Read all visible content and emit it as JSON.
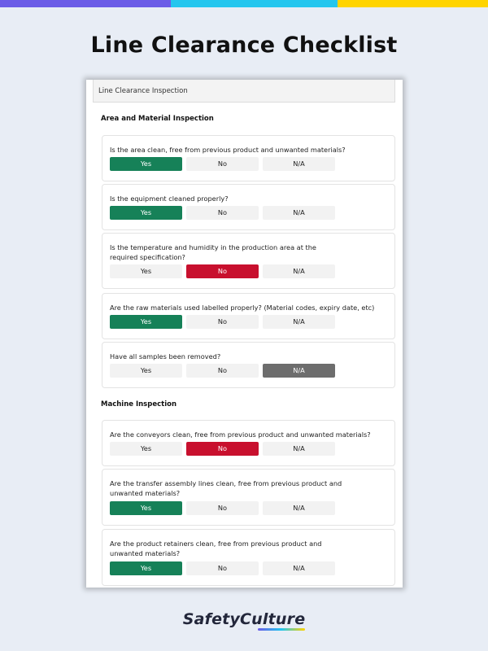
{
  "page": {
    "title": "Line Clearance Checklist"
  },
  "card": {
    "header": "Line Clearance Inspection"
  },
  "sections": [
    {
      "title": "Area and Material Inspection",
      "questions": [
        {
          "text": "Is the area clean, free from previous product and unwanted materials?",
          "options": [
            "Yes",
            "No",
            "N/A"
          ],
          "selected": "Yes"
        },
        {
          "text": "Is the equipment cleaned properly?",
          "options": [
            "Yes",
            "No",
            "N/A"
          ],
          "selected": "Yes"
        },
        {
          "text": "Is the temperature and humidity in the production area at the required specification?",
          "options": [
            "Yes",
            "No",
            "N/A"
          ],
          "selected": "No"
        },
        {
          "text": "Are the raw materials used labelled properly? (Material codes, expiry date, etc)",
          "options": [
            "Yes",
            "No",
            "N/A"
          ],
          "selected": "Yes"
        },
        {
          "text": "Have all samples been removed?",
          "options": [
            "Yes",
            "No",
            "N/A"
          ],
          "selected": "N/A"
        }
      ]
    },
    {
      "title": "Machine Inspection",
      "questions": [
        {
          "text": "Are the conveyors clean, free from previous product and unwanted materials?",
          "options": [
            "Yes",
            "No",
            "N/A"
          ],
          "selected": "No"
        },
        {
          "text": "Are the transfer assembly lines clean, free from previous product and unwanted materials?",
          "options": [
            "Yes",
            "No",
            "N/A"
          ],
          "selected": "Yes"
        },
        {
          "text": "Are the product retainers clean, free from previous product and unwanted materials?",
          "options": [
            "Yes",
            "No",
            "N/A"
          ],
          "selected": "Yes"
        }
      ]
    }
  ],
  "colors": {
    "yes_selected": "#168158",
    "no_selected": "#c8102e",
    "na_selected": "#6d6d6d",
    "option_default": "#f2f2f2",
    "background": "#e8edf5"
  },
  "brand": {
    "name": "SafetyCulture"
  }
}
